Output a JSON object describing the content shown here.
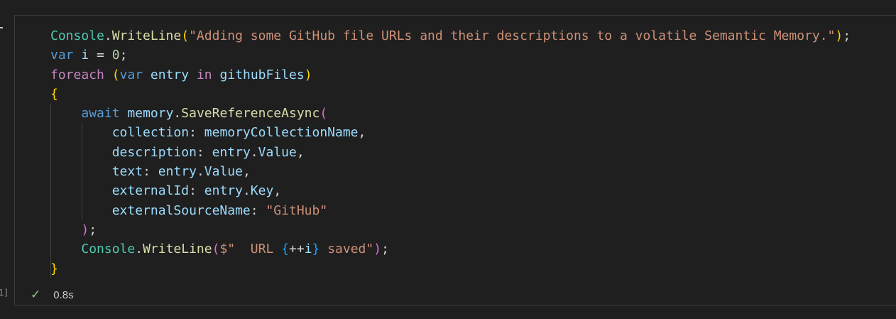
{
  "cell": {
    "status": {
      "icon": "check-icon",
      "duration": "0.8s"
    },
    "code_lines": [
      [
        {
          "t": "Console",
          "c": "t-cls"
        },
        {
          "t": ".",
          "c": "t-p"
        },
        {
          "t": "WriteLine",
          "c": "t-fn"
        },
        {
          "t": "(",
          "c": "t-b1"
        },
        {
          "t": "\"Adding some GitHub file URLs and their descriptions to a volatile Semantic Memory.\"",
          "c": "t-str"
        },
        {
          "t": ")",
          "c": "t-b1"
        },
        {
          "t": ";",
          "c": "t-p"
        }
      ],
      [
        {
          "t": "var",
          "c": "t-kw"
        },
        {
          "t": " ",
          "c": "t-p"
        },
        {
          "t": "i",
          "c": "t-id"
        },
        {
          "t": " = ",
          "c": "t-p"
        },
        {
          "t": "0",
          "c": "t-num"
        },
        {
          "t": ";",
          "c": "t-p"
        }
      ],
      [
        {
          "t": "foreach",
          "c": "t-ctl"
        },
        {
          "t": " ",
          "c": "t-p"
        },
        {
          "t": "(",
          "c": "t-b1"
        },
        {
          "t": "var",
          "c": "t-kw"
        },
        {
          "t": " ",
          "c": "t-p"
        },
        {
          "t": "entry",
          "c": "t-id"
        },
        {
          "t": " ",
          "c": "t-p"
        },
        {
          "t": "in",
          "c": "t-ctl"
        },
        {
          "t": " ",
          "c": "t-p"
        },
        {
          "t": "githubFiles",
          "c": "t-id"
        },
        {
          "t": ")",
          "c": "t-b1"
        }
      ],
      [
        {
          "t": "{",
          "c": "t-b1"
        }
      ],
      [
        {
          "t": "    ",
          "c": "t-p"
        },
        {
          "t": "await",
          "c": "t-kw"
        },
        {
          "t": " ",
          "c": "t-p"
        },
        {
          "t": "memory",
          "c": "t-id"
        },
        {
          "t": ".",
          "c": "t-p"
        },
        {
          "t": "SaveReferenceAsync",
          "c": "t-fn"
        },
        {
          "t": "(",
          "c": "t-b2"
        }
      ],
      [
        {
          "t": "        ",
          "c": "t-p"
        },
        {
          "t": "collection",
          "c": "t-id"
        },
        {
          "t": ": ",
          "c": "t-p"
        },
        {
          "t": "memoryCollectionName",
          "c": "t-id"
        },
        {
          "t": ",",
          "c": "t-p"
        }
      ],
      [
        {
          "t": "        ",
          "c": "t-p"
        },
        {
          "t": "description",
          "c": "t-id"
        },
        {
          "t": ": ",
          "c": "t-p"
        },
        {
          "t": "entry",
          "c": "t-id"
        },
        {
          "t": ".",
          "c": "t-p"
        },
        {
          "t": "Value",
          "c": "t-id"
        },
        {
          "t": ",",
          "c": "t-p"
        }
      ],
      [
        {
          "t": "        ",
          "c": "t-p"
        },
        {
          "t": "text",
          "c": "t-id"
        },
        {
          "t": ": ",
          "c": "t-p"
        },
        {
          "t": "entry",
          "c": "t-id"
        },
        {
          "t": ".",
          "c": "t-p"
        },
        {
          "t": "Value",
          "c": "t-id"
        },
        {
          "t": ",",
          "c": "t-p"
        }
      ],
      [
        {
          "t": "        ",
          "c": "t-p"
        },
        {
          "t": "externalId",
          "c": "t-id"
        },
        {
          "t": ": ",
          "c": "t-p"
        },
        {
          "t": "entry",
          "c": "t-id"
        },
        {
          "t": ".",
          "c": "t-p"
        },
        {
          "t": "Key",
          "c": "t-id"
        },
        {
          "t": ",",
          "c": "t-p"
        }
      ],
      [
        {
          "t": "        ",
          "c": "t-p"
        },
        {
          "t": "externalSourceName",
          "c": "t-id"
        },
        {
          "t": ": ",
          "c": "t-p"
        },
        {
          "t": "\"GitHub\"",
          "c": "t-str"
        }
      ],
      [
        {
          "t": "    ",
          "c": "t-p"
        },
        {
          "t": ")",
          "c": "t-b2"
        },
        {
          "t": ";",
          "c": "t-p"
        }
      ],
      [
        {
          "t": "    ",
          "c": "t-p"
        },
        {
          "t": "Console",
          "c": "t-cls"
        },
        {
          "t": ".",
          "c": "t-p"
        },
        {
          "t": "WriteLine",
          "c": "t-fn"
        },
        {
          "t": "(",
          "c": "t-b2"
        },
        {
          "t": "$\"  URL ",
          "c": "t-str"
        },
        {
          "t": "{",
          "c": "t-b3"
        },
        {
          "t": "++",
          "c": "t-p"
        },
        {
          "t": "i",
          "c": "t-id"
        },
        {
          "t": "}",
          "c": "t-b3"
        },
        {
          "t": " saved\"",
          "c": "t-str"
        },
        {
          "t": ")",
          "c": "t-b2"
        },
        {
          "t": ";",
          "c": "t-p"
        }
      ],
      [
        {
          "t": "}",
          "c": "t-b1"
        }
      ]
    ]
  },
  "gutter": {
    "execution_count": "1]"
  }
}
